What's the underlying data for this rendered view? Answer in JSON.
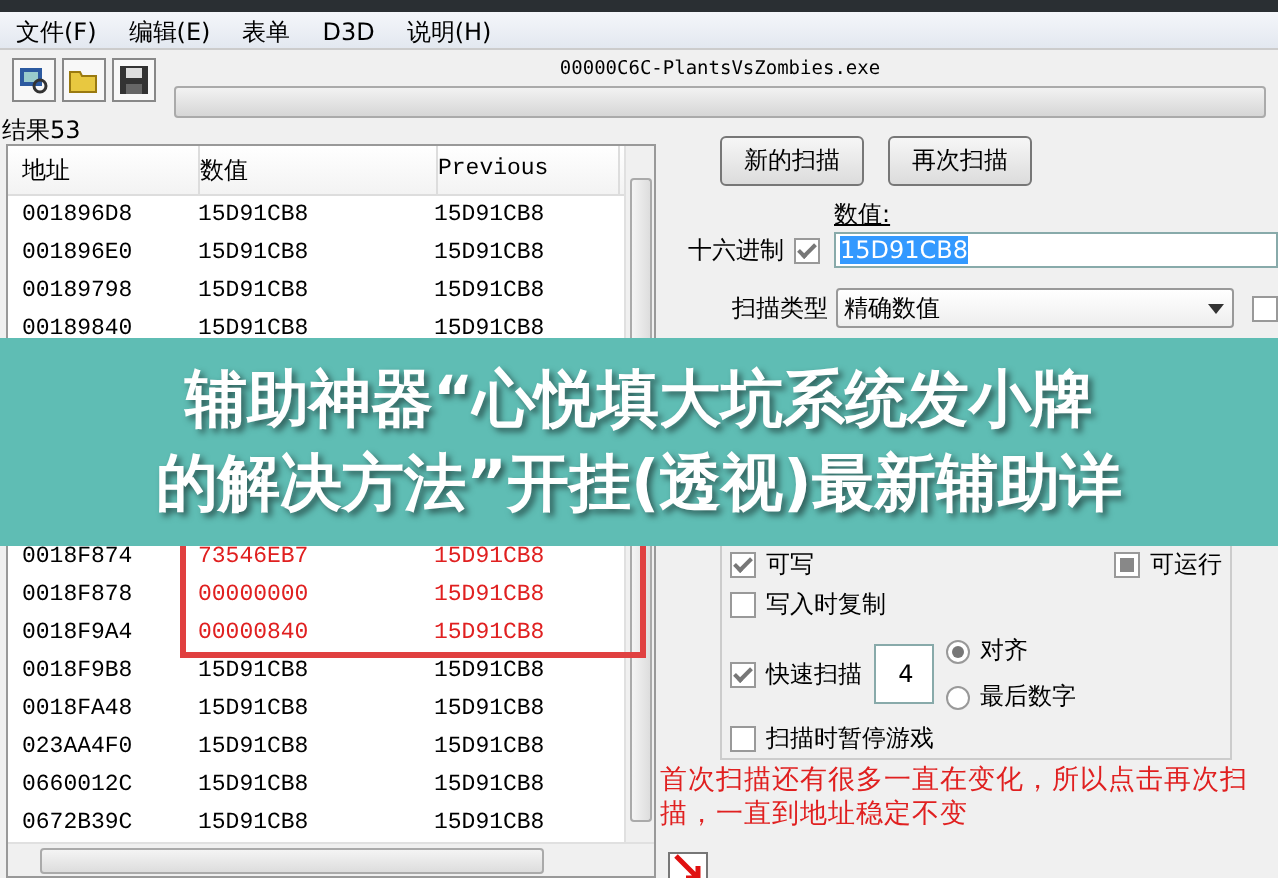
{
  "menu": [
    "文件(F)",
    "编辑(E)",
    "表单",
    "D3D",
    "说明(H)"
  ],
  "process_title": "00000C6C-PlantsVsZombies.exe",
  "scan_progress": {
    "level": 0
  },
  "results_label": "结果53",
  "table": {
    "columns": [
      "地址",
      "数值",
      "Previous"
    ],
    "rows": [
      {
        "cells": [
          "001896D8",
          "15D91CB8",
          "15D91CB8"
        ],
        "changed": false
      },
      {
        "cells": [
          "001896E0",
          "15D91CB8",
          "15D91CB8"
        ],
        "changed": false
      },
      {
        "cells": [
          "00189798",
          "15D91CB8",
          "15D91CB8"
        ],
        "changed": false
      },
      {
        "cells": [
          "00189840",
          "15D91CB8",
          "15D91CB8"
        ],
        "changed": false
      }
    ],
    "rows_after_banner": [
      {
        "cells": [
          "0018F874",
          "73546EB7",
          "15D91CB8"
        ],
        "changed": true
      },
      {
        "cells": [
          "0018F878",
          "00000000",
          "15D91CB8"
        ],
        "changed": true
      },
      {
        "cells": [
          "0018F9A4",
          "00000840",
          "15D91CB8"
        ],
        "changed": true
      },
      {
        "cells": [
          "0018F9B8",
          "15D91CB8",
          "15D91CB8"
        ],
        "changed": false
      },
      {
        "cells": [
          "0018FA48",
          "15D91CB8",
          "15D91CB8"
        ],
        "changed": false
      },
      {
        "cells": [
          "023AA4F0",
          "15D91CB8",
          "15D91CB8"
        ],
        "changed": false
      },
      {
        "cells": [
          "0660012C",
          "15D91CB8",
          "15D91CB8"
        ],
        "changed": false
      },
      {
        "cells": [
          "0672B39C",
          "15D91CB8",
          "15D91CB8"
        ],
        "changed": false
      }
    ]
  },
  "buttons": [
    "新的扫描",
    "再次扫描"
  ],
  "value_label": "数值:",
  "hex": {
    "label": "十六进制",
    "checked": true
  },
  "value": "15D91CB8",
  "scan_type": {
    "label": "扫描类型",
    "value": "精确数值",
    "side_checkbox_checked": false
  },
  "options": [
    {
      "kind": "check",
      "label": "可写",
      "checked": true
    },
    {
      "kind": "tristate",
      "label": "可运行",
      "checked": true
    },
    {
      "kind": "check",
      "label": "写入时复制",
      "checked": false
    },
    {
      "kind": "check",
      "label": "快速扫描",
      "checked": true
    },
    {
      "kind": "check",
      "label": "扫描时暂停游戏",
      "checked": false
    }
  ],
  "fast_scan_value": "4",
  "alignment": [
    {
      "label": "对齐",
      "selected": true
    },
    {
      "label": "最后数字",
      "selected": false
    }
  ],
  "note": "首次扫描还有很多一直在变化，所以点击再次扫描，一直到地址稳定不变",
  "banner": {
    "lines": [
      "辅助神器“心悦填大坑系统发小牌",
      "的解决方法”开挂(透视)最新辅助详"
    ]
  }
}
